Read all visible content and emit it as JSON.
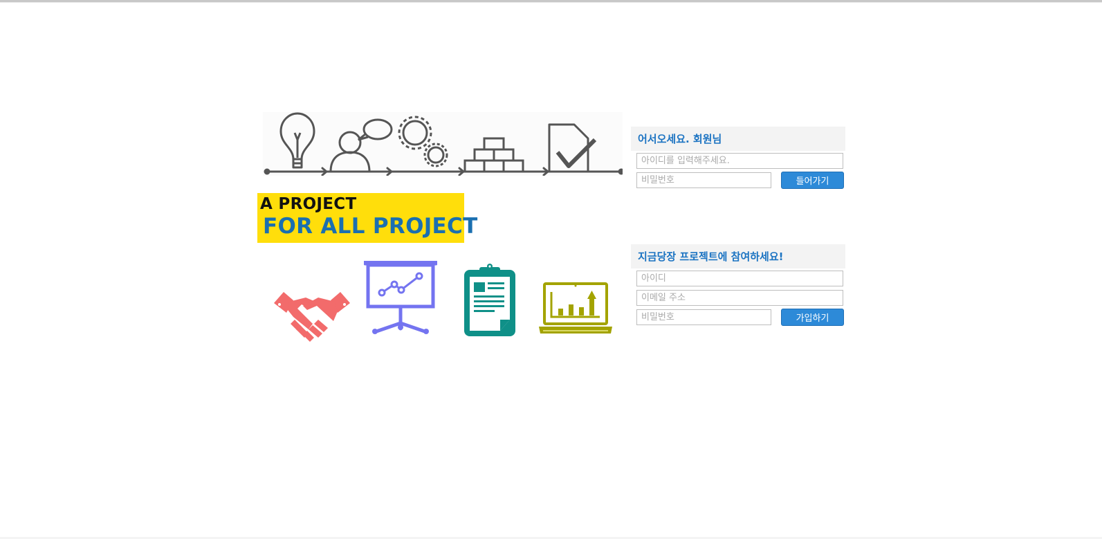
{
  "branding": {
    "logo_line1": "A PROJECT",
    "logo_line2": "FOR ALL PROJECT"
  },
  "illustrations": {
    "process_steps": [
      "lightbulb-icon",
      "person-speech-icon",
      "gears-icon",
      "bricks-icon",
      "document-check-icon"
    ],
    "features": [
      "handshake-icon",
      "presentation-board-icon",
      "clipboard-icon",
      "laptop-chart-icon"
    ]
  },
  "login": {
    "title": "어서오세요. 회원님",
    "id_placeholder": "아이디를 입력해주세요.",
    "password_placeholder": "비밀번호",
    "submit_label": "들어가기"
  },
  "signup": {
    "title": "지금당장 프로젝트에 참여하세요!",
    "id_placeholder": "아이디",
    "email_placeholder": "이메일 주소",
    "password_placeholder": "비밀번호",
    "submit_label": "가입하기"
  },
  "colors": {
    "accent": "#2d8ad8",
    "heading": "#1b73c2",
    "logo_bg": "#ffde0b",
    "handshake": "#f26b6b",
    "presentation": "#7474f0",
    "clipboard": "#0f9088",
    "laptop": "#a3a300"
  }
}
